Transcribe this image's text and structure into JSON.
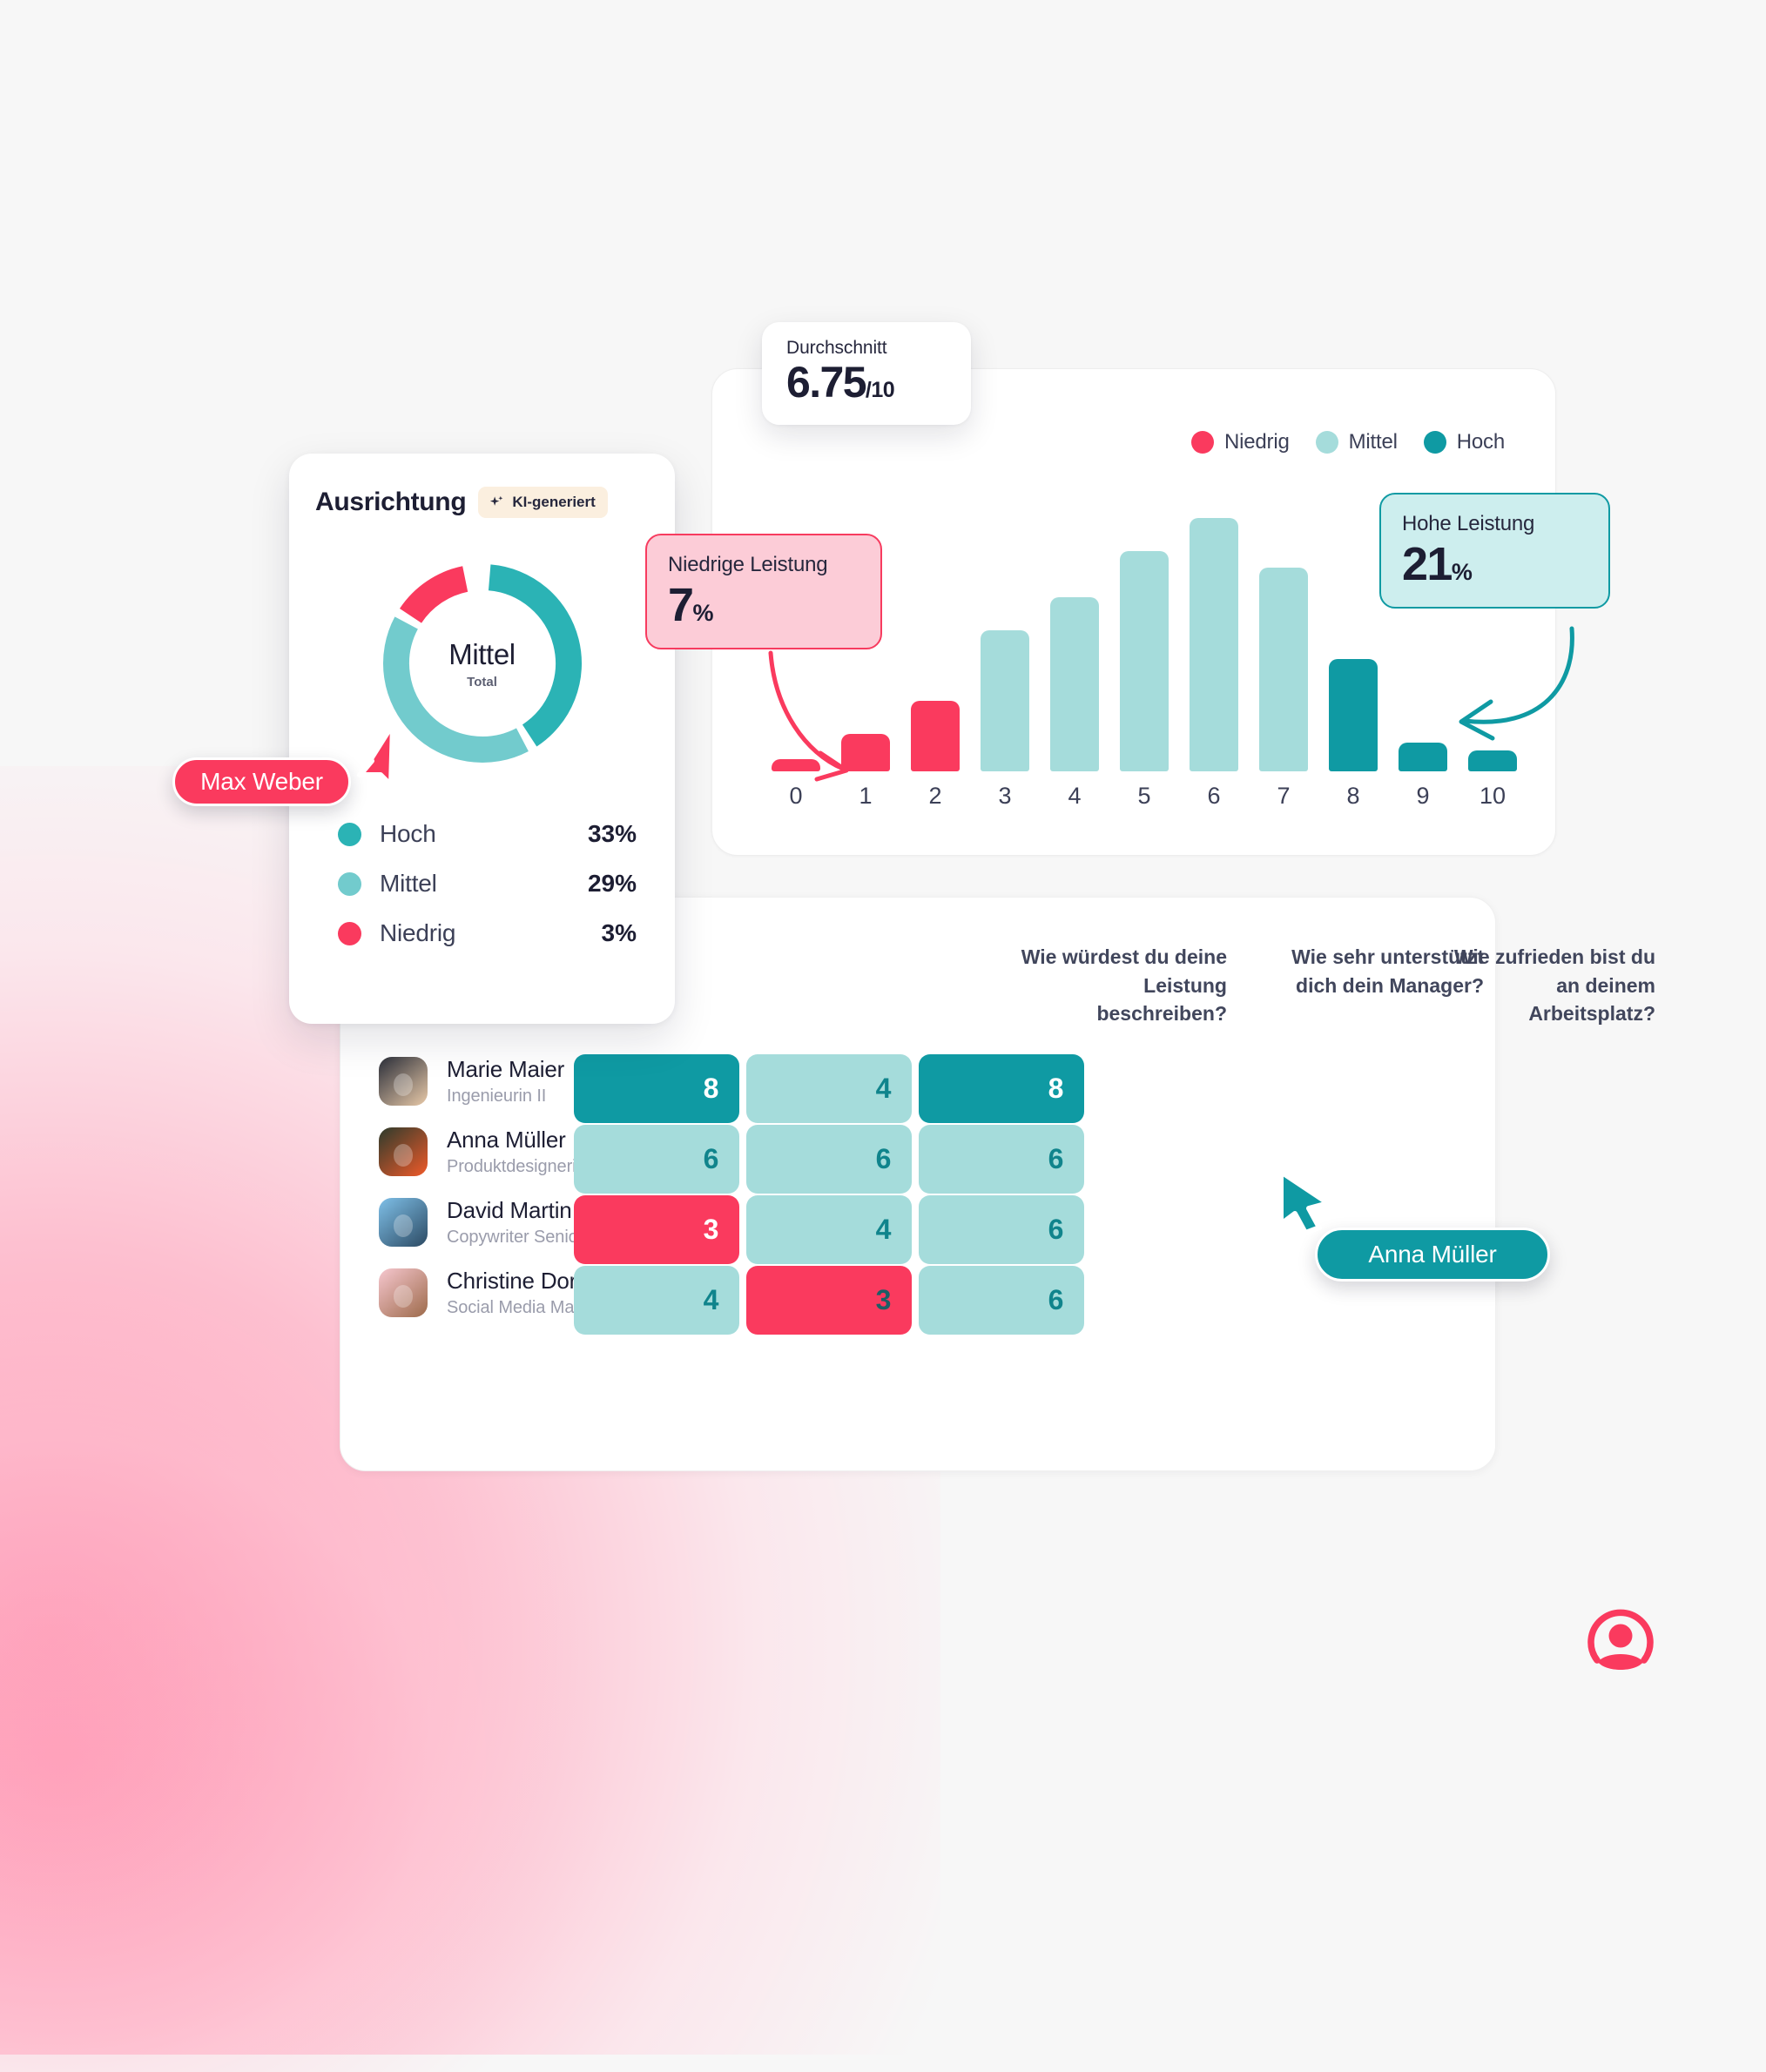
{
  "theme": {
    "brand_red": "#fa3a5e",
    "teal_dark": "#0f9aa3",
    "teal_mid": "#4cbcbf",
    "teal_light": "#a5dcdb",
    "ink": "#1d1e33",
    "page_bg": "#f7f7f7"
  },
  "donut_card": {
    "title": "Ausrichtung",
    "ai_badge": "KI-generiert",
    "center_label": "Mittel",
    "center_sub": "Total",
    "legend": [
      {
        "label": "Hoch",
        "value": "33%",
        "color": "#2bb3b5"
      },
      {
        "label": "Mittel",
        "value": "29%",
        "color": "#72cbcd"
      },
      {
        "label": "Niedrig",
        "value": "3%",
        "color": "#fa3a5e"
      }
    ],
    "segments": [
      {
        "label": "Hoch",
        "percent": 41,
        "color": "#2bb3b5"
      },
      {
        "label": "Mittel",
        "percent": 42,
        "color": "#72cbcd"
      },
      {
        "label": "Niedrig",
        "percent": 14,
        "color": "#fa3a5e"
      }
    ]
  },
  "average_card": {
    "label": "Durchschnitt",
    "value": "6.75",
    "unit": "/10"
  },
  "callouts": {
    "low": {
      "title": "Niedrige Leistung",
      "value": "7",
      "pct": "%"
    },
    "high": {
      "title": "Hohe Leistung",
      "value": "21",
      "pct": "%"
    }
  },
  "chart_data": {
    "type": "bar",
    "title": "",
    "xlabel": "",
    "ylabel": "",
    "categories": [
      "0",
      "1",
      "2",
      "3",
      "4",
      "5",
      "6",
      "7",
      "8",
      "9",
      "10"
    ],
    "values": [
      3,
      9,
      17,
      34,
      42,
      53,
      61,
      49,
      27,
      7,
      5
    ],
    "ylim": [
      0,
      65
    ],
    "grid": false,
    "legend_position": "top-right",
    "bar_colors": [
      "#fa3a5e",
      "#fa3a5e",
      "#fa3a5e",
      "#a5dcdb",
      "#a5dcdb",
      "#a5dcdb",
      "#a5dcdb",
      "#a5dcdb",
      "#0f9aa3",
      "#0f9aa3",
      "#0f9aa3"
    ],
    "legend": [
      {
        "label": "Niedrig",
        "color": "#fa3a5e"
      },
      {
        "label": "Mittel",
        "color": "#a5dcdb"
      },
      {
        "label": "Hoch",
        "color": "#0f9aa3"
      }
    ],
    "annotations": [
      {
        "text": "Niedrige Leistung 7%",
        "points_to": "0"
      },
      {
        "text": "Hohe Leistung 21%",
        "points_to": "9"
      }
    ]
  },
  "table": {
    "columns": [
      "Wie würdest du deine Leistung beschreiben?",
      "Wie sehr unterstützt dich dein Manager?",
      "Wie zufrieden bist du an deinem Arbeitsplatz?"
    ],
    "rows": [
      {
        "name": "Marie Maier",
        "role": "Ingenieurin II",
        "avatar_colors": [
          "#2b2f3a",
          "#e8c9a8"
        ],
        "scores": [
          {
            "value": "8",
            "bg": "#0f9aa3",
            "fg": "#ffffff"
          },
          {
            "value": "4",
            "bg": "#a5dcdb",
            "fg": "#10848c"
          },
          {
            "value": "8",
            "bg": "#0f9aa3",
            "fg": "#ffffff"
          }
        ]
      },
      {
        "name": "Anna Müller",
        "role": "Produktdesignerin",
        "avatar_colors": [
          "#2d3b2c",
          "#f05a2a"
        ],
        "scores": [
          {
            "value": "6",
            "bg": "#a5dcdb",
            "fg": "#10848c"
          },
          {
            "value": "6",
            "bg": "#a5dcdb",
            "fg": "#10848c"
          },
          {
            "value": "6",
            "bg": "#a5dcdb",
            "fg": "#10848c"
          }
        ]
      },
      {
        "name": "David Martin",
        "role": "Copywriter Senior",
        "avatar_colors": [
          "#7fc0e8",
          "#2c4a63"
        ],
        "scores": [
          {
            "value": "3",
            "bg": "#fa3a5e",
            "fg": "#ffffff"
          },
          {
            "value": "4",
            "bg": "#a5dcdb",
            "fg": "#10848c"
          },
          {
            "value": "6",
            "bg": "#a5dcdb",
            "fg": "#10848c"
          }
        ]
      },
      {
        "name": "Christine Dorfer",
        "role": "Social Media Manager",
        "avatar_colors": [
          "#f6c7cf",
          "#9d6a4a"
        ],
        "scores": [
          {
            "value": "4",
            "bg": "#a5dcdb",
            "fg": "#10848c"
          },
          {
            "value": "3",
            "bg": "#fa3a5e",
            "fg": "#1d5e66"
          },
          {
            "value": "6",
            "bg": "#a5dcdb",
            "fg": "#10848c"
          }
        ]
      }
    ]
  },
  "pointers": {
    "max_weber": "Max Weber",
    "anna_mueller": "Anna Müller"
  },
  "logo": {
    "name": "person-circle-logo",
    "color": "#fa3a5e"
  }
}
